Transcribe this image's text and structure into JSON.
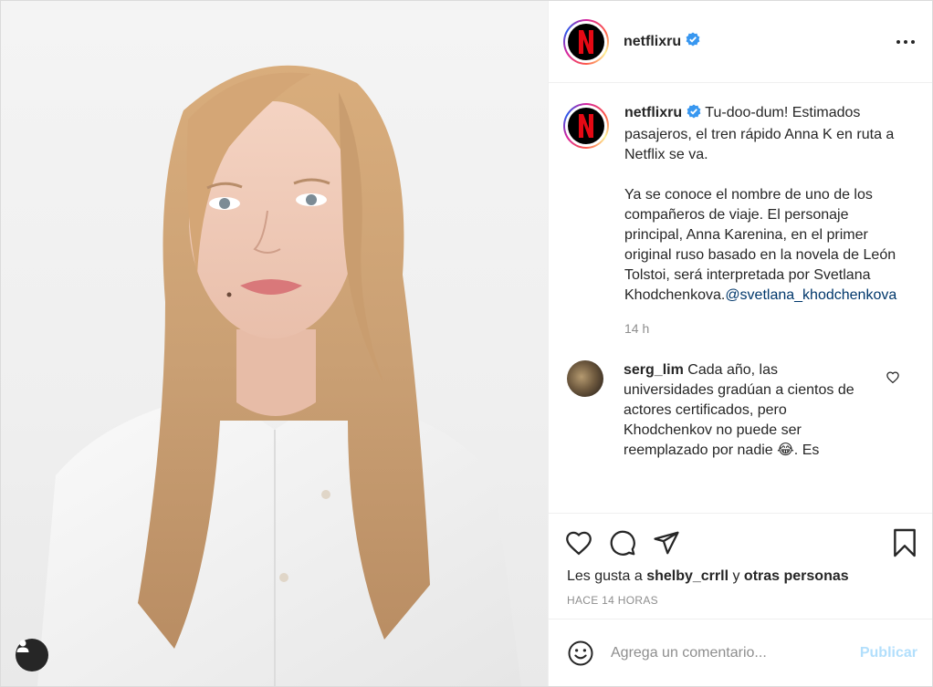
{
  "post": {
    "username": "netflixru",
    "verified": true,
    "brand_color": "#e50914",
    "caption": {
      "username": "netflixru",
      "text": "Tu-doo-dum! Estimados pasajeros, el tren rápido Anna K en ruta a Netflix se va.\n\nYa se conoce el nombre de uno de los compañeros de viaje. El personaje principal, Anna Karenina, en el primer original ruso basado en la novela de León Tolstoi, será interpretada por Svetlana Khodchenkova.",
      "mention": "@svetlana_khodchenkova",
      "time": "14 h"
    },
    "comments": [
      {
        "username": "serg_lim",
        "text": "Cada año, las universidades gradúan a cientos de actores certificados, pero Khodchenkov no puede ser reemplazado por nadie 😂. Es"
      }
    ],
    "likes": {
      "prefix": "Les gusta a",
      "user": "shelby_crrll",
      "middle": "y",
      "others": "otras personas"
    },
    "posted_ago": "HACE 14 HORAS",
    "comment_input": {
      "placeholder": "Agrega un comentario...",
      "value": ""
    },
    "publish_label": "Publicar",
    "icons": {
      "more": "more-options-icon",
      "like": "heart-icon",
      "comment": "comment-bubble-icon",
      "share": "paper-plane-icon",
      "save": "bookmark-icon",
      "emoji": "emoji-smiley-icon",
      "tag": "user-tag-icon"
    }
  }
}
